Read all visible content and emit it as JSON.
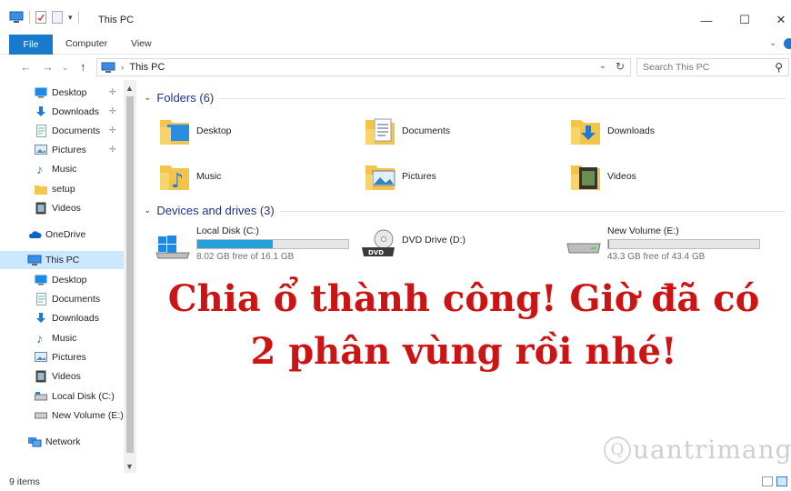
{
  "window": {
    "title": "This PC",
    "minimize_glyph": "—",
    "maximize_glyph": "☐",
    "close_glyph": "✕"
  },
  "ribbon": {
    "tabs": [
      "File",
      "Computer",
      "View"
    ],
    "collapse_glyph": "⌄"
  },
  "address": {
    "crumb": "This PC",
    "back_glyph": "←",
    "forward_glyph": "→",
    "recent_glyph": "⌄",
    "up_glyph": "↑",
    "dropdown_glyph": "⌄",
    "refresh_glyph": "↻",
    "sep_glyph": "›"
  },
  "search": {
    "placeholder": "Search This PC",
    "icon_glyph": "⚲"
  },
  "nav": {
    "quick_access": [
      {
        "label": "Desktop",
        "icon": "desktop-icon",
        "pinned": true
      },
      {
        "label": "Downloads",
        "icon": "downloads-icon",
        "pinned": true
      },
      {
        "label": "Documents",
        "icon": "documents-icon",
        "pinned": true
      },
      {
        "label": "Pictures",
        "icon": "pictures-icon",
        "pinned": true
      },
      {
        "label": "Music",
        "icon": "music-icon",
        "pinned": false
      },
      {
        "label": "setup",
        "icon": "folder-icon",
        "pinned": false
      },
      {
        "label": "Videos",
        "icon": "videos-icon",
        "pinned": false
      }
    ],
    "onedrive": "OneDrive",
    "this_pc": "This PC",
    "this_pc_items": [
      {
        "label": "Desktop",
        "icon": "desktop-icon"
      },
      {
        "label": "Documents",
        "icon": "documents-icon"
      },
      {
        "label": "Downloads",
        "icon": "downloads-icon"
      },
      {
        "label": "Music",
        "icon": "music-icon"
      },
      {
        "label": "Pictures",
        "icon": "pictures-icon"
      },
      {
        "label": "Videos",
        "icon": "videos-icon"
      },
      {
        "label": "Local Disk (C:)",
        "icon": "drive-icon"
      },
      {
        "label": "New Volume (E:)",
        "icon": "drive-icon"
      }
    ],
    "network": "Network",
    "pin_glyph": "✢",
    "scroll_up_glyph": "▲",
    "scroll_down_glyph": "▼"
  },
  "folders": {
    "header": "Folders (6)",
    "chevron_glyph": "⌄",
    "items": [
      {
        "label": "Desktop",
        "icon": "desktop-folder-icon"
      },
      {
        "label": "Documents",
        "icon": "documents-folder-icon"
      },
      {
        "label": "Downloads",
        "icon": "downloads-folder-icon"
      },
      {
        "label": "Music",
        "icon": "music-folder-icon"
      },
      {
        "label": "Pictures",
        "icon": "pictures-folder-icon"
      },
      {
        "label": "Videos",
        "icon": "videos-folder-icon"
      }
    ]
  },
  "drives": {
    "header": "Devices and drives (3)",
    "chevron_glyph": "⌄",
    "items": [
      {
        "name": "Local Disk (C:)",
        "free": "8.02 GB free of 16.1 GB",
        "used_fraction": 0.5,
        "icon": "windows-drive-icon"
      },
      {
        "name": "DVD Drive (D:)",
        "free": "",
        "used_fraction": null,
        "icon": "dvd-drive-icon",
        "icon_label": "DVD"
      },
      {
        "name": "New Volume (E:)",
        "free": "43.3 GB free of 43.4 GB",
        "used_fraction": 0.002,
        "icon": "drive-icon"
      }
    ]
  },
  "caption": {
    "line1": "Chia ổ thành công! Giờ đã có",
    "line2": "2 phân vùng rồi nhé!"
  },
  "watermark": {
    "glyph": "Q",
    "text": "uantrimang"
  },
  "status": {
    "items": "9 items"
  },
  "colors": {
    "accent": "#1979ca",
    "selection": "#cce8ff",
    "progress": "#26a0da",
    "caption": "#cc1414",
    "group_header": "#1e3287"
  }
}
